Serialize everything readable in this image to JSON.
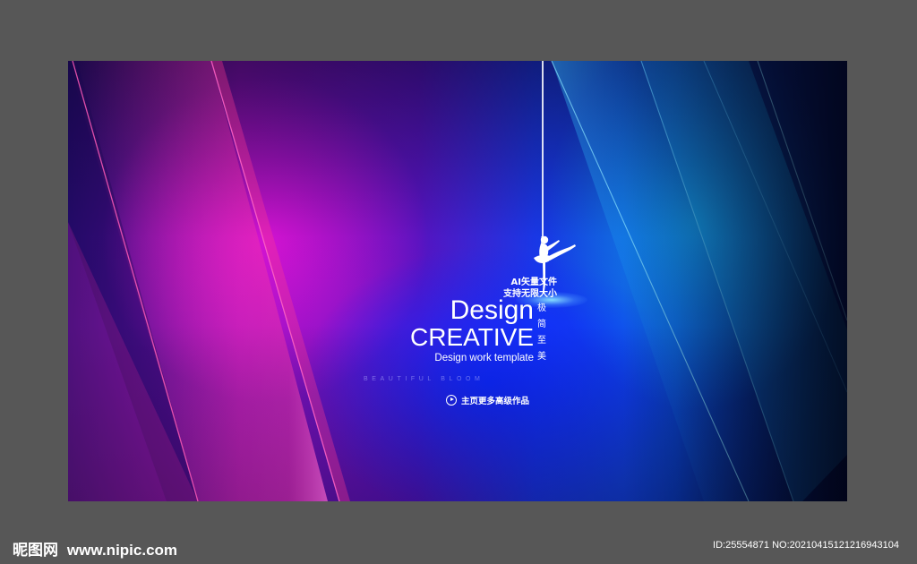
{
  "poster": {
    "ai_line1": "AI矢量文件",
    "ai_line2": "支持无限大小",
    "design_word": "Design",
    "creative_word": "CREATIVE",
    "subtitle": "Design work template",
    "beautiful_text": "BEAUTIFUL BLOOM",
    "vertical_chars": [
      "极",
      "简",
      "至",
      "美"
    ],
    "more_works_link": "主页更多高级作品"
  },
  "footer": {
    "logo_text": "昵图网",
    "url_text": "www.nipic.com",
    "id_text": "ID:25554871 NO:20210415121216943104"
  },
  "colors": {
    "background": "#575757",
    "magenta": "#e014dc",
    "blue": "#1a3af0",
    "cyan": "#14aaf0",
    "text": "#ffffff"
  },
  "icons": {
    "play": "play-circle-icon",
    "dancer": "ballet-dancer-icon"
  }
}
